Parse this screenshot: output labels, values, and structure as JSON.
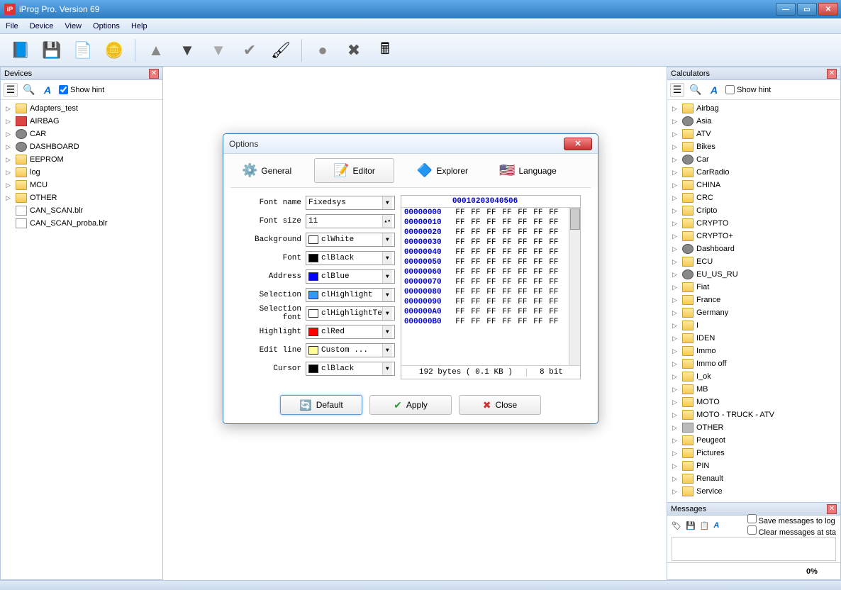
{
  "window": {
    "title": "iProg Pro. Version 69"
  },
  "menu": {
    "file": "File",
    "device": "Device",
    "view": "View",
    "options": "Options",
    "help": "Help"
  },
  "panels": {
    "devices": {
      "title": "Devices",
      "show_hint": "Show hint"
    },
    "calculators": {
      "title": "Calculators",
      "show_hint": "Show hint"
    },
    "messages": {
      "title": "Messages",
      "save": "Save messages to log",
      "clear": "Clear messages at sta"
    }
  },
  "devices_tree": [
    {
      "label": "Adapters_test",
      "icon": "folder"
    },
    {
      "label": "AIRBAG",
      "icon": "red"
    },
    {
      "label": "CAR",
      "icon": "grey"
    },
    {
      "label": "DASHBOARD",
      "icon": "grey"
    },
    {
      "label": "EEPROM",
      "icon": "folder"
    },
    {
      "label": "log",
      "icon": "folder"
    },
    {
      "label": "MCU",
      "icon": "folder"
    },
    {
      "label": "OTHER",
      "icon": "folder"
    },
    {
      "label": "CAN_SCAN.blr",
      "icon": "file",
      "leaf": true
    },
    {
      "label": "CAN_SCAN_proba.blr",
      "icon": "file",
      "leaf": true
    }
  ],
  "calc_tree": [
    {
      "label": "Airbag",
      "icon": "folder"
    },
    {
      "label": "Asia",
      "icon": "grey"
    },
    {
      "label": "ATV",
      "icon": "folder"
    },
    {
      "label": "Bikes",
      "icon": "folder"
    },
    {
      "label": "Car",
      "icon": "grey"
    },
    {
      "label": "CarRadio",
      "icon": "folder"
    },
    {
      "label": "CHINA",
      "icon": "folder"
    },
    {
      "label": "CRC",
      "icon": "folder"
    },
    {
      "label": "Cripto",
      "icon": "folder"
    },
    {
      "label": "CRYPTO",
      "icon": "folder"
    },
    {
      "label": "CRYPTO+",
      "icon": "folder"
    },
    {
      "label": "Dashboard",
      "icon": "grey"
    },
    {
      "label": "ECU",
      "icon": "folder"
    },
    {
      "label": "EU_US_RU",
      "icon": "grey"
    },
    {
      "label": "Fiat",
      "icon": "folder"
    },
    {
      "label": "France",
      "icon": "folder"
    },
    {
      "label": "Germany",
      "icon": "folder"
    },
    {
      "label": "I",
      "icon": "folder"
    },
    {
      "label": "IDEN",
      "icon": "folder"
    },
    {
      "label": "Immo",
      "icon": "folder"
    },
    {
      "label": "Immo off",
      "icon": "folder"
    },
    {
      "label": "I_ok",
      "icon": "folder"
    },
    {
      "label": "MB",
      "icon": "folder"
    },
    {
      "label": "MOTO",
      "icon": "folder"
    },
    {
      "label": "MOTO - TRUCK - ATV",
      "icon": "folder"
    },
    {
      "label": "OTHER",
      "icon": "calc"
    },
    {
      "label": "Peugeot",
      "icon": "folder"
    },
    {
      "label": "Pictures",
      "icon": "folder"
    },
    {
      "label": "PIN",
      "icon": "folder"
    },
    {
      "label": "Renault",
      "icon": "folder"
    },
    {
      "label": "Service",
      "icon": "folder"
    }
  ],
  "dialog": {
    "title": "Options",
    "tabs": {
      "general": "General",
      "editor": "Editor",
      "explorer": "Explorer",
      "language": "Language"
    },
    "labels": {
      "fontname": "Font name",
      "fontsize": "Font size",
      "background": "Background",
      "font": "Font",
      "address": "Address",
      "selection": "Selection",
      "selectionfont": "Selection font",
      "highlight": "Highlight",
      "editline": "Edit line",
      "cursor": "Cursor"
    },
    "values": {
      "fontname": "Fixedsys",
      "fontsize": "11",
      "background": "clWhite",
      "font": "clBlack",
      "address": "clBlue",
      "selection": "clHighlight",
      "selectionfont": "clHighlightTe",
      "highlight": "clRed",
      "editline": "Custom ...",
      "cursor": "clBlack"
    },
    "colors": {
      "background": "#ffffff",
      "font": "#000000",
      "address": "#0000ff",
      "selection": "#3399ff",
      "selectionfont": "#ffffff",
      "highlight": "#ff0000",
      "editline": "#ffff99",
      "cursor": "#000000"
    },
    "hex": {
      "cols": [
        "00",
        "01",
        "02",
        "03",
        "04",
        "05",
        "06"
      ],
      "rows": [
        {
          "addr": "00000000",
          "b": [
            "FF",
            "FF",
            "FF",
            "FF",
            "FF",
            "FF",
            "FF"
          ]
        },
        {
          "addr": "00000010",
          "b": [
            "FF",
            "FF",
            "FF",
            "FF",
            "FF",
            "FF",
            "FF"
          ]
        },
        {
          "addr": "00000020",
          "b": [
            "FF",
            "FF",
            "FF",
            "FF",
            "FF",
            "FF",
            "FF"
          ]
        },
        {
          "addr": "00000030",
          "b": [
            "FF",
            "FF",
            "FF",
            "FF",
            "FF",
            "FF",
            "FF"
          ]
        },
        {
          "addr": "00000040",
          "b": [
            "FF",
            "FF",
            "FF",
            "FF",
            "FF",
            "FF",
            "FF"
          ]
        },
        {
          "addr": "00000050",
          "b": [
            "FF",
            "FF",
            "FF",
            "FF",
            "FF",
            "FF",
            "FF"
          ]
        },
        {
          "addr": "00000060",
          "b": [
            "FF",
            "FF",
            "FF",
            "FF",
            "FF",
            "FF",
            "FF"
          ]
        },
        {
          "addr": "00000070",
          "b": [
            "FF",
            "FF",
            "FF",
            "FF",
            "FF",
            "FF",
            "FF"
          ]
        },
        {
          "addr": "00000080",
          "b": [
            "FF",
            "FF",
            "FF",
            "FF",
            "FF",
            "FF",
            "FF"
          ]
        },
        {
          "addr": "00000090",
          "b": [
            "FF",
            "FF",
            "FF",
            "FF",
            "FF",
            "FF",
            "FF"
          ]
        },
        {
          "addr": "000000A0",
          "b": [
            "FF",
            "FF",
            "FF",
            "FF",
            "FF",
            "FF",
            "FF"
          ]
        },
        {
          "addr": "000000B0",
          "b": [
            "FF",
            "FF",
            "FF",
            "FF",
            "FF",
            "FF",
            "FF"
          ]
        }
      ],
      "status1": "192 bytes ( 0.1 KB )",
      "status2": "8 bit"
    },
    "buttons": {
      "default": "Default",
      "apply": "Apply",
      "close": "Close"
    }
  },
  "status": {
    "percent": "0%"
  }
}
